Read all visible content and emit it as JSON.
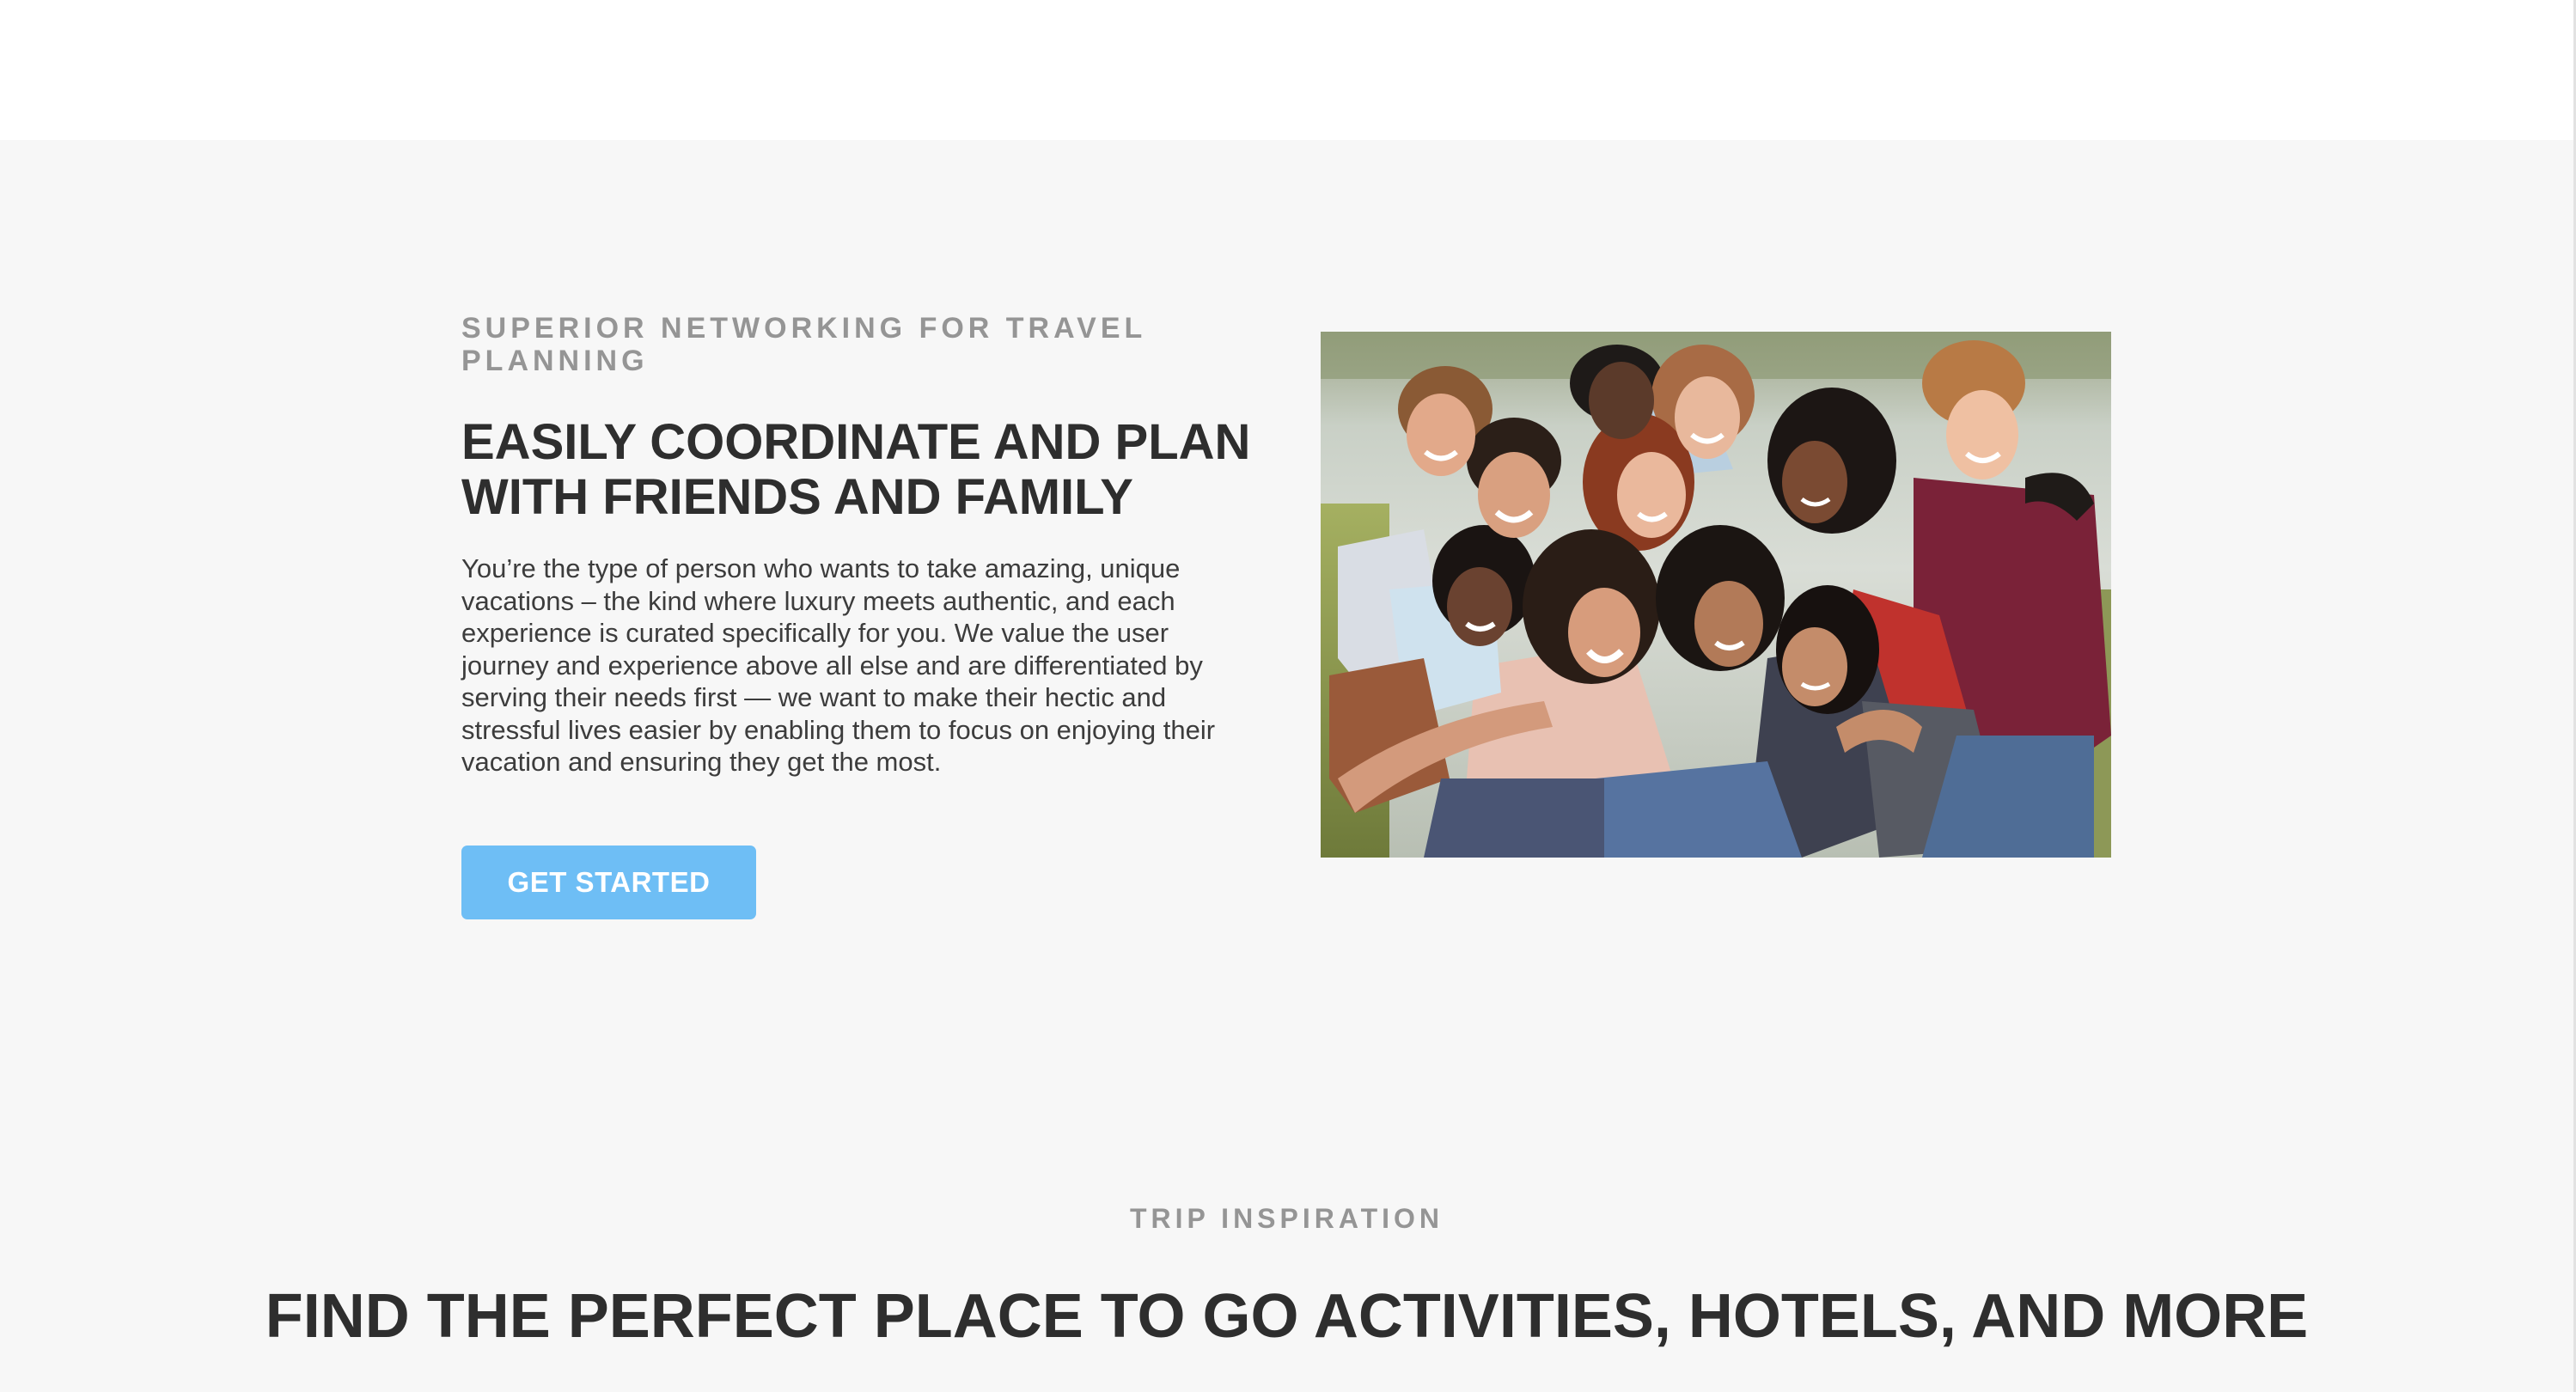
{
  "hero": {
    "eyebrow": "SUPERIOR NETWORKING FOR TRAVEL PLANNING",
    "title": "EASILY COORDINATE AND PLAN WITH FRIENDS AND FAMILY",
    "body": "You’re the type of person who wants to take amazing, unique vacations – the kind where luxury meets authentic, and each experience is curated specifically for you. We value the user journey and experience above all else and are differentiated by serving their needs first — we want to make their hectic and stressful lives easier by enabling them to focus on enjoying their vacation and ensuring they get the most.",
    "cta_label": "GET STARTED",
    "image_icon": "group-of-friends-photo"
  },
  "inspiration": {
    "eyebrow": "TRIP INSPIRATION",
    "title": "FIND THE PERFECT PLACE TO GO ACTIVITIES, HOTELS, AND MORE"
  },
  "colors": {
    "page_bg": "#f7f7f7",
    "header_bg": "#ffffff",
    "heading": "#2e2e2e",
    "eyebrow": "#959595",
    "body_text": "#3c3c3c",
    "cta_bg": "#6ebef5",
    "cta_text": "#ffffff"
  }
}
